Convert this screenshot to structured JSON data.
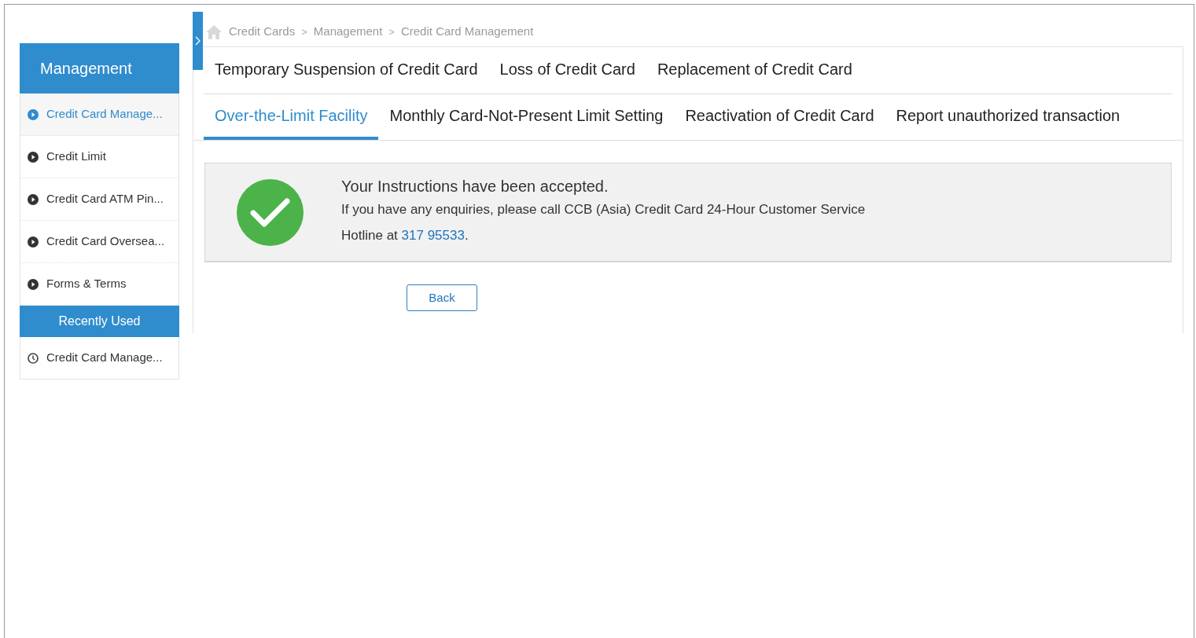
{
  "sidebar": {
    "title": "Management",
    "items": [
      {
        "label": "Credit Card Manage...",
        "selected": true
      },
      {
        "label": "Credit Limit",
        "selected": false
      },
      {
        "label": "Credit Card ATM Pin...",
        "selected": false
      },
      {
        "label": "Credit Card Oversea...",
        "selected": false
      },
      {
        "label": "Forms & Terms",
        "selected": false
      }
    ],
    "recent_title": "Recently Used",
    "recent_items": [
      {
        "label": "Credit Card Manage..."
      }
    ]
  },
  "breadcrumb": [
    "Credit Cards",
    "Management",
    "Credit Card Management"
  ],
  "breadcrumb_separator": ">",
  "tab_rows": [
    [
      {
        "label": "Temporary Suspension of Credit Card",
        "selected": false
      },
      {
        "label": "Loss of Credit Card",
        "selected": false
      },
      {
        "label": "Replacement of Credit Card",
        "selected": false
      }
    ],
    [
      {
        "label": "Over-the-Limit Facility",
        "selected": true
      },
      {
        "label": "Monthly Card-Not-Present Limit Setting",
        "selected": false
      },
      {
        "label": "Reactivation of Credit Card",
        "selected": false
      },
      {
        "label": "Report unauthorized transaction",
        "selected": false
      }
    ]
  ],
  "message": {
    "title": "Your Instructions have been accepted.",
    "text_before": "If you have any enquiries, please call CCB (Asia) Credit Card 24-Hour Customer Service Hotline at ",
    "phone": "317 95533",
    "text_after": "."
  },
  "back_button": "Back"
}
